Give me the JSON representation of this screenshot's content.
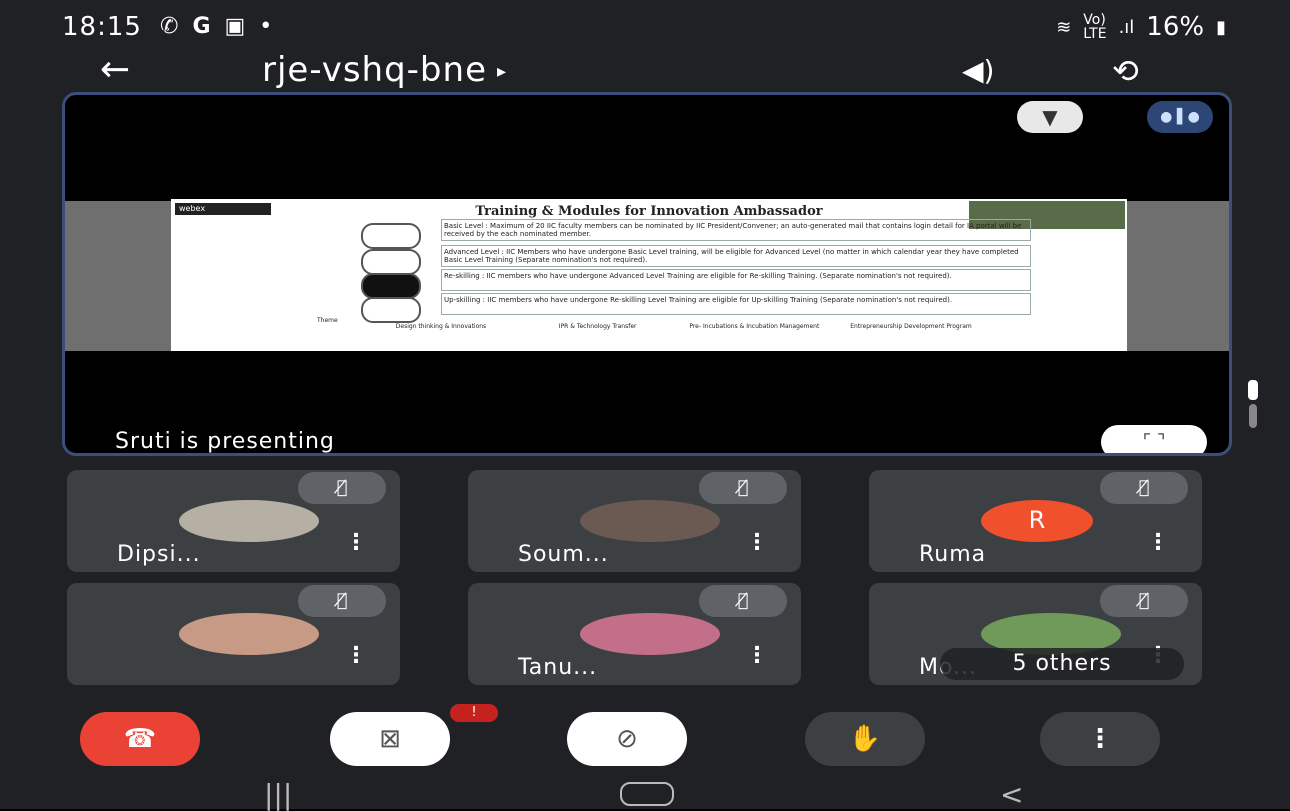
{
  "status_bar": {
    "time": "18:15",
    "left_icons": [
      "whatsapp-icon",
      "google-icon",
      "gallery-icon",
      "dot-icon"
    ],
    "right_text": "16%",
    "network_labels": [
      "Vo)",
      "LTE"
    ]
  },
  "header": {
    "meeting_code": "rje-vshq-bne",
    "caret": "▸"
  },
  "stage": {
    "presenting_label": "Sruti is presenting",
    "slide": {
      "brand": "webex",
      "title": "Training & Modules for Innovation Ambassador",
      "levels": [
        {
          "name": "Basic Level",
          "text": "Basic Level : Maximum of 20 IIC faculty members can be nominated by IIC President/Convener; an auto-generated mail that contains login detail for IA portal will be received by the each nominated member."
        },
        {
          "name": "Advanced Level",
          "text": "Advanced Level : IIC Members who have undergone Basic Level training, will be eligible for Advanced Level (no matter in which calendar year they have completed Basic Level Training (Separate nomination's not required)."
        },
        {
          "name": "Re-skilling",
          "text": "Re-skilling : IIC members who have undergone Advanced Level Training are eligible for Re-skilling Training. (Separate nomination's not required)."
        },
        {
          "name": "Up-skilling",
          "text": "Up-skilling : IIC members who have undergone Re-skilling Level Training are eligible for Up-skilling Training (Separate nomination's not required)."
        }
      ],
      "theme_label": "Theme",
      "themes": [
        "Design thinking & Innovations",
        "IPR & Technology Transfer",
        "Pre- Incubations & Incubation Management",
        "Entrepreneurship Development Program"
      ]
    }
  },
  "participants": [
    {
      "name": "Dipsi...",
      "muted": true
    },
    {
      "name": "Soum...",
      "muted": true
    },
    {
      "name": "Ruma",
      "initial": "R",
      "muted": true
    },
    {
      "name": "",
      "muted": true
    },
    {
      "name": "Tanu...",
      "muted": true
    },
    {
      "name": "Mo...",
      "muted": true
    }
  ],
  "others_label": "5 others",
  "controls": {
    "end_call": "end-call-icon",
    "camera": "camera-off-icon",
    "camera_badge": "!",
    "mic": "mic-off-icon",
    "raise_hand": "hand-icon",
    "more": "more-icon"
  },
  "colors": {
    "end_call": "#ea4335",
    "stage_border": "#3b4f7a",
    "tile_bg": "#3c4043",
    "ruma_avatar": "#f0502b"
  }
}
